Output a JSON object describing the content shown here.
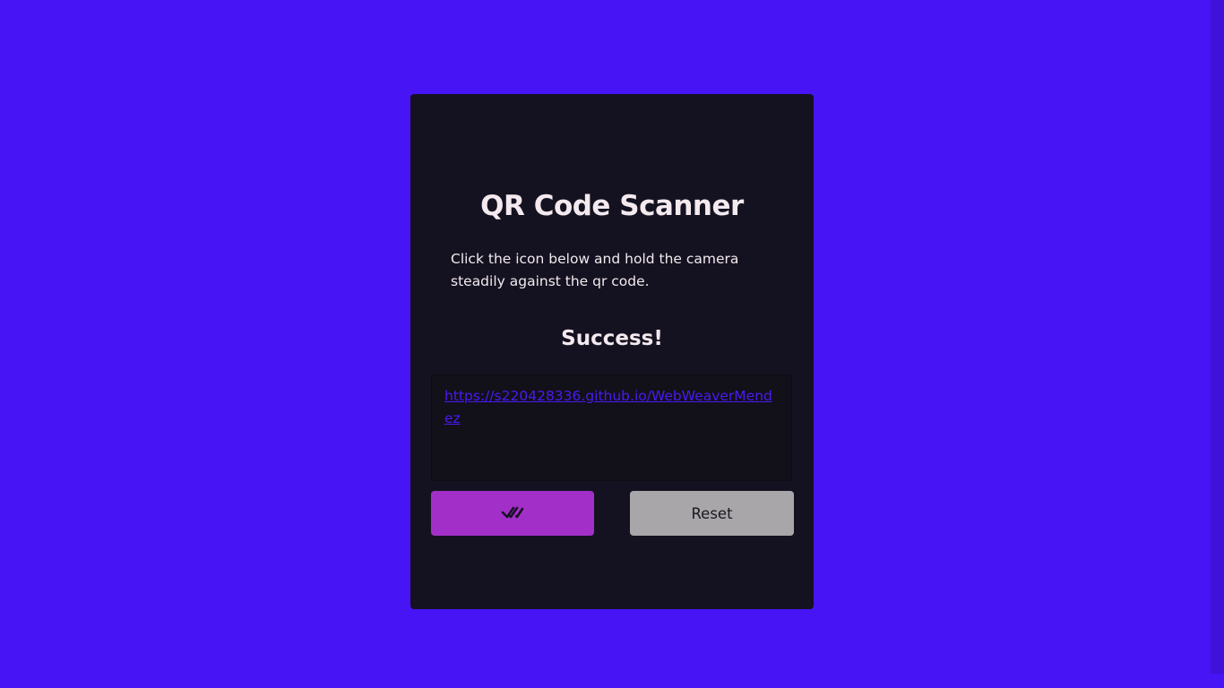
{
  "scanner": {
    "title": "QR Code Scanner",
    "description": "Click the icon below and hold the camera steadily against the qr code.",
    "status": "Success!",
    "result_url": "https://s220428336.github.io/WebWeaverMendez",
    "confirm_icon": "double-check-icon",
    "reset_label": "Reset"
  },
  "colors": {
    "page_background": "#4714f5",
    "card_background": "#141220",
    "text": "#f3e9ee",
    "link": "#4a1af2",
    "confirm_button": "#a230c8",
    "reset_button": "#a8a6a8"
  }
}
